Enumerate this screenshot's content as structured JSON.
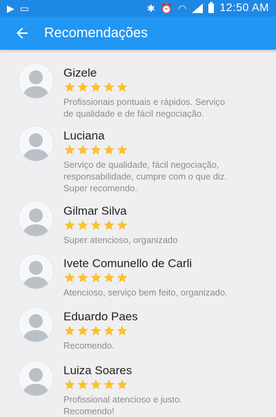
{
  "status_bar": {
    "time": "12:50 AM",
    "icons": [
      "play-icon",
      "cast-icon",
      "bluetooth-icon",
      "alarm-icon",
      "wifi-icon",
      "signal-icon",
      "battery-icon"
    ]
  },
  "header": {
    "title": "Recomendações",
    "back_icon": "arrow-back-icon"
  },
  "colors": {
    "app_bar": "#2196f3",
    "status_bar": "#1e88e5",
    "star": "#fbc02d",
    "background": "#efeff1"
  },
  "reviews": [
    {
      "name": "Gizele",
      "rating": 5,
      "comment": "Profissionais pontuais e rápidos. Serviço\nde qualidade e de fácil  negociação."
    },
    {
      "name": "Luciana",
      "rating": 5,
      "comment": "Serviço de qualidade, fácil negociação,\nresponsabilidade, cumpre com o que diz.\nSuper recomendo."
    },
    {
      "name": "Gilmar Silva",
      "rating": 5,
      "comment": "Super atencioso, organizado"
    },
    {
      "name": "Ivete Comunello de Carli",
      "rating": 5,
      "comment": "Atencioso, serviço bem feito, organizado."
    },
    {
      "name": "Eduardo Paes",
      "rating": 5,
      "comment": "Recomendo."
    },
    {
      "name": "Luiza Soares",
      "rating": 5,
      "comment": "Profissional atencioso e justo.\nRecomendo!"
    }
  ]
}
